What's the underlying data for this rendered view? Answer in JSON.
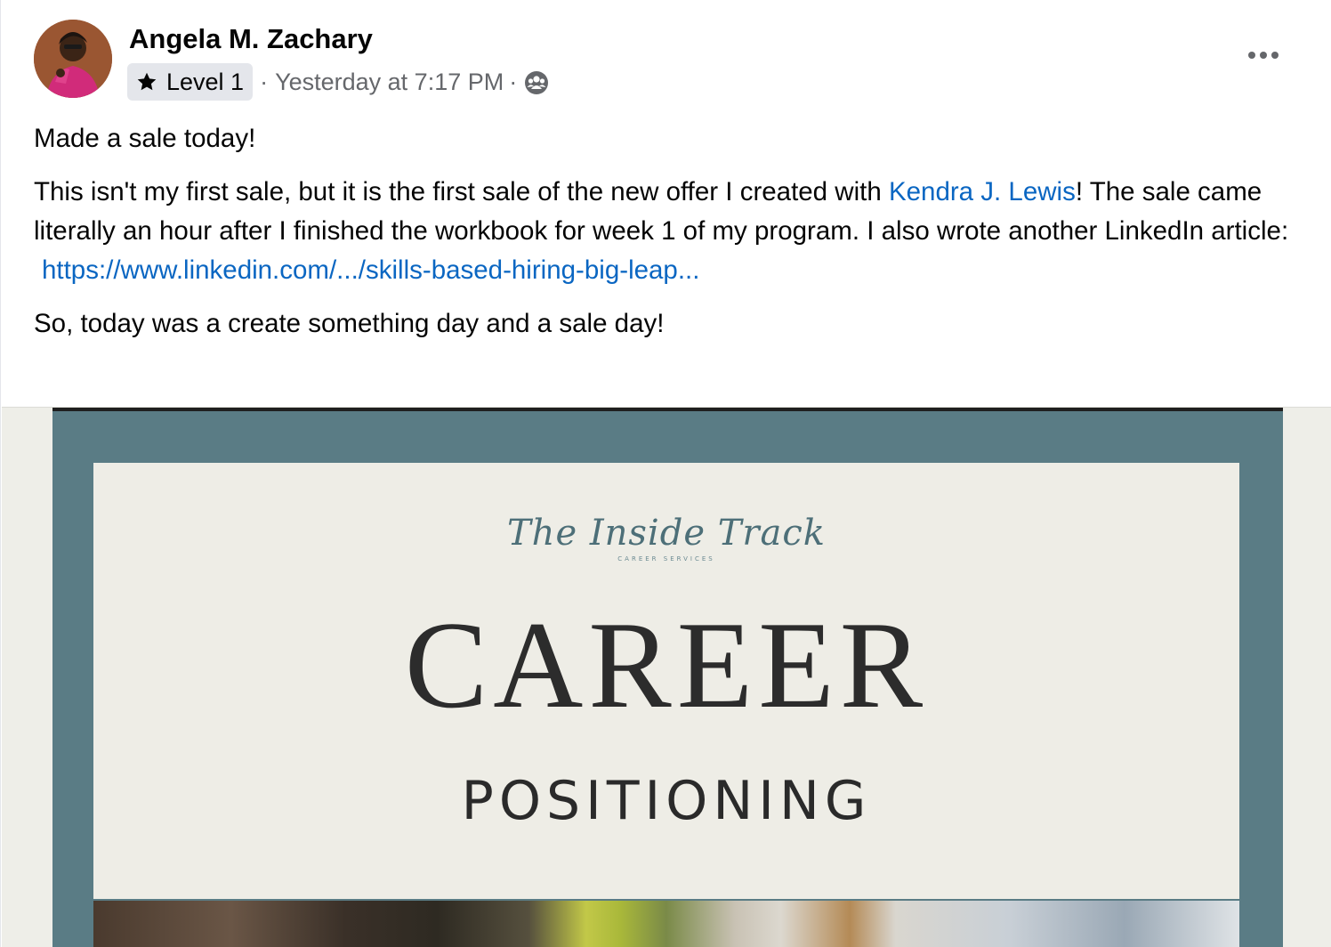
{
  "post": {
    "author": "Angela M. Zachary",
    "badge_label": "Level 1",
    "separator": "·",
    "timestamp": "Yesterday at 7:17 PM",
    "body": {
      "line1": "Made a sale today!",
      "p2_before_link": "This isn't my first sale, but it is the first sale of the new offer I created with ",
      "mention": "Kendra J. Lewis",
      "p2_after_link": "! The sale came literally an hour after I finished the workbook for week 1 of my program. I also wrote another LinkedIn article:",
      "url": "https://www.linkedin.com/.../skills-based-hiring-big-leap...",
      "line3": "So, today was a create something day and a sale day!"
    }
  },
  "media": {
    "brand_script": "The Inside Track",
    "brand_sub": "CAREER SERVICES",
    "title": "CAREER",
    "subtitle": "POSITIONING"
  },
  "icons": {
    "avatar": "profile-photo",
    "badge": "star-icon",
    "audience": "group-icon",
    "menu": "more-options-icon"
  },
  "colors": {
    "link": "#0a66c2",
    "cover_frame": "#5a7c85",
    "cover_paper": "#eeede6",
    "badge_bg": "#e4e6eb"
  }
}
